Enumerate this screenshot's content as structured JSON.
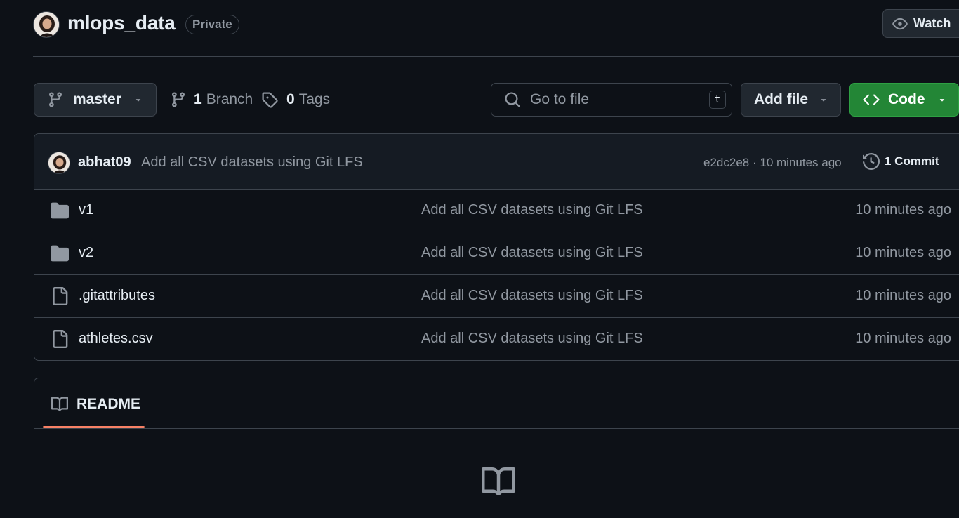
{
  "header": {
    "repo_name": "mlops_data",
    "visibility": "Private",
    "watch_label": "Watch"
  },
  "toolbar": {
    "branch": "master",
    "branch_count": "1",
    "branch_label": "Branch",
    "tag_count": "0",
    "tag_label": "Tags",
    "search_placeholder": "Go to file",
    "search_shortcut": "t",
    "add_file_label": "Add file",
    "code_label": "Code"
  },
  "latest_commit": {
    "author": "abhat09",
    "message": "Add all CSV datasets using Git LFS",
    "hash": "e2dc2e8",
    "separator": "·",
    "time": "10 minutes ago",
    "commit_count": "1 Commit"
  },
  "files": [
    {
      "name": "v1",
      "type": "folder",
      "message": "Add all CSV datasets using Git LFS",
      "time": "10 minutes ago"
    },
    {
      "name": "v2",
      "type": "folder",
      "message": "Add all CSV datasets using Git LFS",
      "time": "10 minutes ago"
    },
    {
      "name": ".gitattributes",
      "type": "file",
      "message": "Add all CSV datasets using Git LFS",
      "time": "10 minutes ago"
    },
    {
      "name": "athletes.csv",
      "type": "file",
      "message": "Add all CSV datasets using Git LFS",
      "time": "10 minutes ago"
    }
  ],
  "readme": {
    "tab_label": "README"
  },
  "colors": {
    "background": "#0d1117",
    "border": "#3d444d",
    "code_button": "#238636",
    "tab_underline": "#f78166",
    "muted_text": "#9198a1"
  }
}
